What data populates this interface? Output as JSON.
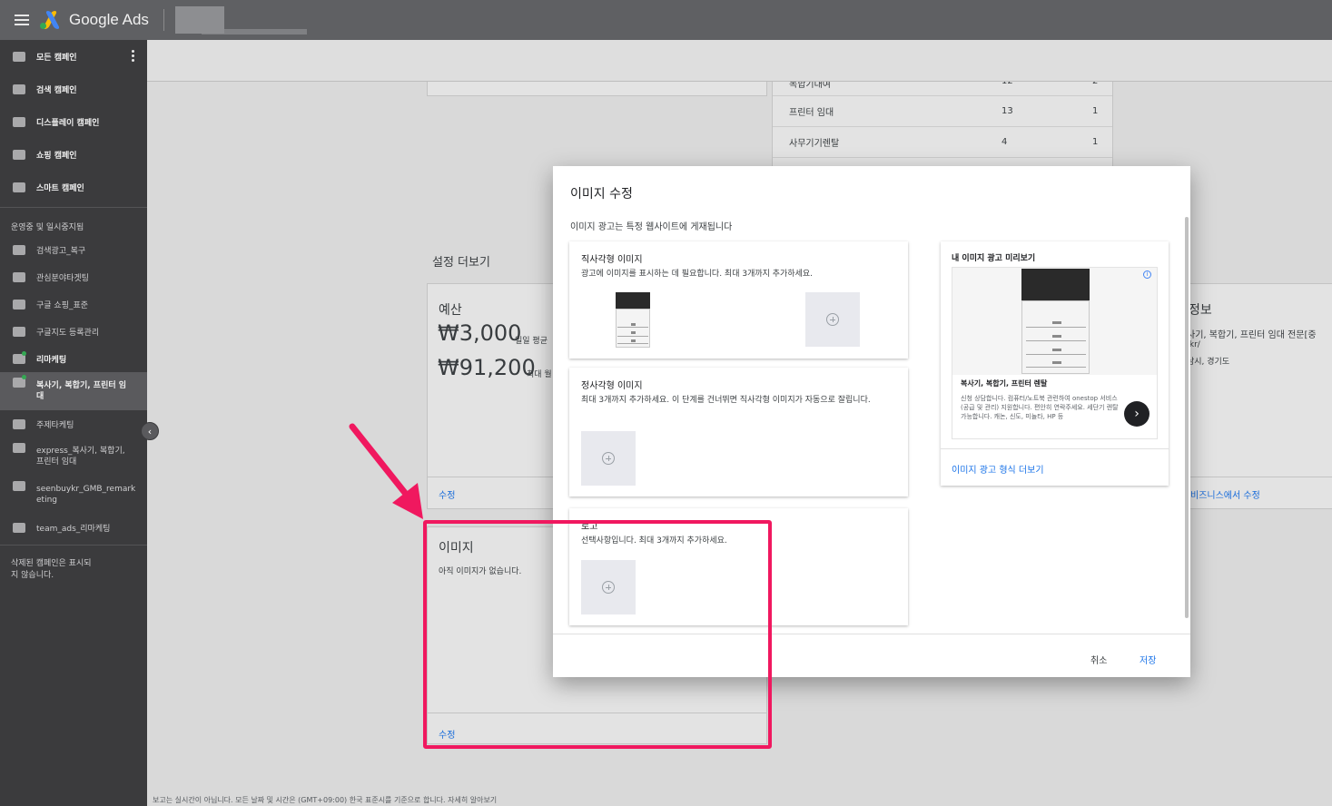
{
  "topbar": {
    "brand": "Google Ads"
  },
  "sidebar": {
    "items": [
      {
        "label": "모든 캠페인"
      },
      {
        "label": "검색 캠페인"
      },
      {
        "label": "디스플레이 캠페인"
      },
      {
        "label": "쇼핑 캠페인"
      },
      {
        "label": "스마트 캠페인"
      }
    ],
    "section_heading": "운영중 및 일시중지됨",
    "campaigns": [
      {
        "label": "검색광고_복구"
      },
      {
        "label": "관심분야타겟팅"
      },
      {
        "label": "구글 쇼핑_표준"
      },
      {
        "label": "구글지도 등록관리"
      },
      {
        "label": "리마케팅"
      },
      {
        "label": "복사기, 복합기, 프린터 임대"
      },
      {
        "label": "주제타케팅"
      },
      {
        "label": "express_복사기, 복합기, 프린터 임대"
      },
      {
        "label": "seenbuykr_GMB_remarketing"
      },
      {
        "label": "team_ads_리마케팅"
      }
    ],
    "footer": "삭제된 캠페인은 표시되지 않습니다."
  },
  "background": {
    "keywords": [
      {
        "name": "복합기대여",
        "a": "12",
        "b": "2"
      },
      {
        "name": "프린터 임대",
        "a": "13",
        "b": "1"
      },
      {
        "name": "사무기기렌탈",
        "a": "4",
        "b": "1"
      }
    ],
    "more_settings": "설정 더보기",
    "budget_card": {
      "title": "예산",
      "daily_amount": "₩3,000",
      "daily_suffix": "일일 평균",
      "max_amount": "₩91,200",
      "max_suffix": "최대 월",
      "edit": "수정"
    },
    "images_card": {
      "title": "이미지",
      "empty": "아직 이미지가 없습니다.",
      "edit": "수정"
    },
    "business_card": {
      "title": "정보",
      "line1": "사기, 복합기, 프린터 임대 전문[중",
      "line2": ".kr/",
      "line3": "남시, 경기도",
      "edit": "비즈니스에서 수정"
    },
    "footer_note": "보고는 실시간이 아닙니다. 모든 날짜 및 시간은 (GMT+09:00) 한국 표준시를 기준으로 합니다. 자세히 알아보기"
  },
  "dialog": {
    "title": "이미지 수정",
    "subtitle": "이미지 광고는 특정 웹사이트에 게재됩니다",
    "landscape": {
      "title": "직사각형 이미지",
      "desc": "광고에 이미지를 표시하는 데 필요합니다. 최대 3개까지 추가하세요."
    },
    "square": {
      "title": "정사각형 이미지",
      "desc": "최대 3개까지 추가하세요. 이 단계를 건너뛰면 직사각형 이미지가 자동으로 잘립니다."
    },
    "logo": {
      "title": "로고",
      "desc": "선택사항입니다. 최대 3개까지 추가하세요."
    },
    "preview": {
      "title": "내 이미지 광고 미리보기",
      "headline": "복사기, 복합기, 프린터 렌탈",
      "body": "신청 상담합니다. 컴퓨터/노트북 관련하여 onestop 서비스(공급 및 관리) 지원합니다. 편안히 연락주세요. 세단기 렌탈 가능합니다. 캐논, 신도, 미놀타, HP 등",
      "more_link": "이미지 광고 형식 더보기"
    },
    "cancel": "취소",
    "save": "저장"
  },
  "colors": {
    "accent": "#1a73e8",
    "annotation": "#f0185f",
    "sidebar_bg": "#3b3b3d",
    "topbar_bg": "#5f6063"
  }
}
